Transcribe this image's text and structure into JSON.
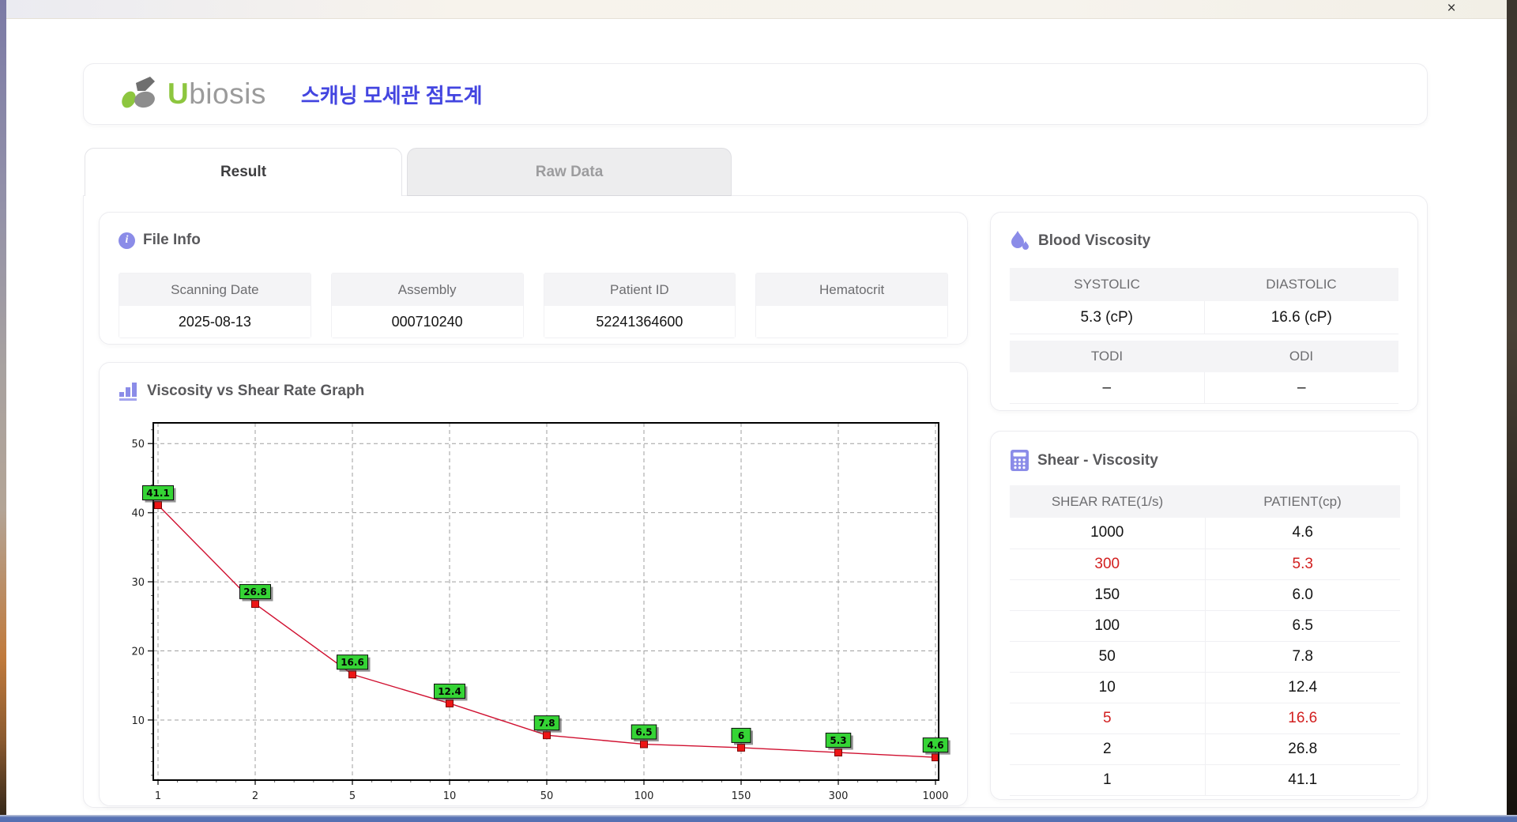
{
  "titlebar": {
    "close": "×"
  },
  "header": {
    "brand_green": "U",
    "brand_gray": "biosis",
    "app_title": "스캐닝 모세관 점도계"
  },
  "tabs": {
    "result": "Result",
    "raw_data": "Raw Data"
  },
  "file_info": {
    "title": "File Info",
    "fields": [
      {
        "label": "Scanning Date",
        "value": "2025-08-13"
      },
      {
        "label": "Assembly",
        "value": "000710240"
      },
      {
        "label": "Patient ID",
        "value": "52241364600"
      },
      {
        "label": "Hematocrit",
        "value": ""
      }
    ]
  },
  "blood_viscosity": {
    "title": "Blood Viscosity",
    "pairs": [
      {
        "h1": "SYSTOLIC",
        "h2": "DIASTOLIC",
        "v1": "5.3 (cP)",
        "v2": "16.6 (cP)"
      },
      {
        "h1": "TODI",
        "h2": "ODI",
        "v1": "–",
        "v2": "–"
      }
    ]
  },
  "graph": {
    "title": "Viscosity vs Shear Rate Graph"
  },
  "chart_data": {
    "type": "line",
    "title": "Viscosity vs Shear Rate Graph",
    "x_axis_type": "category-log-spaced-evenly",
    "categories": [
      1,
      2,
      5,
      10,
      50,
      100,
      150,
      300,
      1000
    ],
    "series": [
      {
        "name": "PATIENT(cp)",
        "values": [
          41.1,
          26.8,
          16.6,
          12.4,
          7.8,
          6.5,
          6.0,
          5.3,
          4.6
        ]
      }
    ],
    "point_labels": [
      "41.1",
      "26.8",
      "16.6",
      "12.4",
      "7.8",
      "6.5",
      "6",
      "5.3",
      "4.6"
    ],
    "xlabel": "",
    "ylabel": "",
    "ylim": [
      1.3,
      53
    ],
    "yticks": [
      10,
      20,
      30,
      40,
      50
    ],
    "y_minor_step": 2,
    "grid": true,
    "legend": "none",
    "line_color": "#d01030",
    "marker_color": "#ed1515",
    "marker_border": "#7d0606",
    "label_bg": "#35d435",
    "label_border": "#0a0a0a",
    "grid_color": "#9f9f9f"
  },
  "shear_viscosity": {
    "title": "Shear - Viscosity",
    "columns": [
      "SHEAR RATE(1/s)",
      "PATIENT(cp)"
    ],
    "rows": [
      {
        "shear": "1000",
        "patient": "4.6",
        "highlight": false
      },
      {
        "shear": "300",
        "patient": "5.3",
        "highlight": true
      },
      {
        "shear": "150",
        "patient": "6.0",
        "highlight": false
      },
      {
        "shear": "100",
        "patient": "6.5",
        "highlight": false
      },
      {
        "shear": "50",
        "patient": "7.8",
        "highlight": false
      },
      {
        "shear": "10",
        "patient": "12.4",
        "highlight": false
      },
      {
        "shear": "5",
        "patient": "16.6",
        "highlight": true
      },
      {
        "shear": "2",
        "patient": "26.8",
        "highlight": false
      },
      {
        "shear": "1",
        "patient": "41.1",
        "highlight": false
      }
    ]
  }
}
